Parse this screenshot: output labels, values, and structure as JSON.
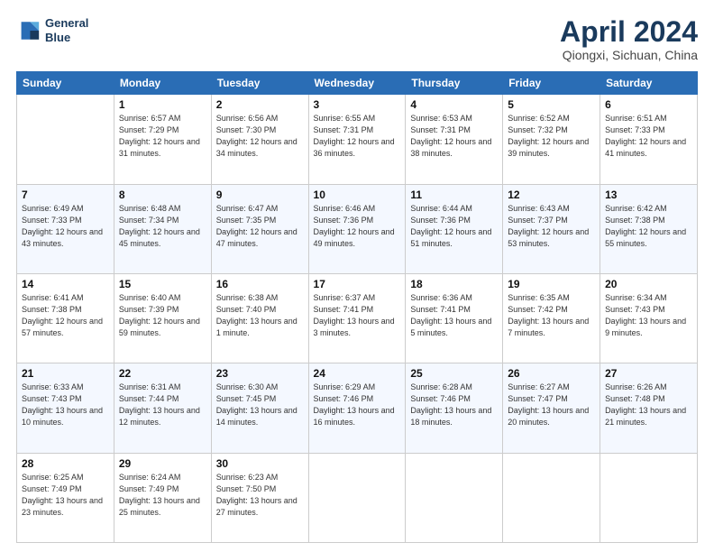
{
  "logo": {
    "line1": "General",
    "line2": "Blue"
  },
  "title": "April 2024",
  "location": "Qiongxi, Sichuan, China",
  "days_of_week": [
    "Sunday",
    "Monday",
    "Tuesday",
    "Wednesday",
    "Thursday",
    "Friday",
    "Saturday"
  ],
  "weeks": [
    [
      {
        "num": "",
        "sunrise": "",
        "sunset": "",
        "daylight": ""
      },
      {
        "num": "1",
        "sunrise": "Sunrise: 6:57 AM",
        "sunset": "Sunset: 7:29 PM",
        "daylight": "Daylight: 12 hours and 31 minutes."
      },
      {
        "num": "2",
        "sunrise": "Sunrise: 6:56 AM",
        "sunset": "Sunset: 7:30 PM",
        "daylight": "Daylight: 12 hours and 34 minutes."
      },
      {
        "num": "3",
        "sunrise": "Sunrise: 6:55 AM",
        "sunset": "Sunset: 7:31 PM",
        "daylight": "Daylight: 12 hours and 36 minutes."
      },
      {
        "num": "4",
        "sunrise": "Sunrise: 6:53 AM",
        "sunset": "Sunset: 7:31 PM",
        "daylight": "Daylight: 12 hours and 38 minutes."
      },
      {
        "num": "5",
        "sunrise": "Sunrise: 6:52 AM",
        "sunset": "Sunset: 7:32 PM",
        "daylight": "Daylight: 12 hours and 39 minutes."
      },
      {
        "num": "6",
        "sunrise": "Sunrise: 6:51 AM",
        "sunset": "Sunset: 7:33 PM",
        "daylight": "Daylight: 12 hours and 41 minutes."
      }
    ],
    [
      {
        "num": "7",
        "sunrise": "Sunrise: 6:49 AM",
        "sunset": "Sunset: 7:33 PM",
        "daylight": "Daylight: 12 hours and 43 minutes."
      },
      {
        "num": "8",
        "sunrise": "Sunrise: 6:48 AM",
        "sunset": "Sunset: 7:34 PM",
        "daylight": "Daylight: 12 hours and 45 minutes."
      },
      {
        "num": "9",
        "sunrise": "Sunrise: 6:47 AM",
        "sunset": "Sunset: 7:35 PM",
        "daylight": "Daylight: 12 hours and 47 minutes."
      },
      {
        "num": "10",
        "sunrise": "Sunrise: 6:46 AM",
        "sunset": "Sunset: 7:36 PM",
        "daylight": "Daylight: 12 hours and 49 minutes."
      },
      {
        "num": "11",
        "sunrise": "Sunrise: 6:44 AM",
        "sunset": "Sunset: 7:36 PM",
        "daylight": "Daylight: 12 hours and 51 minutes."
      },
      {
        "num": "12",
        "sunrise": "Sunrise: 6:43 AM",
        "sunset": "Sunset: 7:37 PM",
        "daylight": "Daylight: 12 hours and 53 minutes."
      },
      {
        "num": "13",
        "sunrise": "Sunrise: 6:42 AM",
        "sunset": "Sunset: 7:38 PM",
        "daylight": "Daylight: 12 hours and 55 minutes."
      }
    ],
    [
      {
        "num": "14",
        "sunrise": "Sunrise: 6:41 AM",
        "sunset": "Sunset: 7:38 PM",
        "daylight": "Daylight: 12 hours and 57 minutes."
      },
      {
        "num": "15",
        "sunrise": "Sunrise: 6:40 AM",
        "sunset": "Sunset: 7:39 PM",
        "daylight": "Daylight: 12 hours and 59 minutes."
      },
      {
        "num": "16",
        "sunrise": "Sunrise: 6:38 AM",
        "sunset": "Sunset: 7:40 PM",
        "daylight": "Daylight: 13 hours and 1 minute."
      },
      {
        "num": "17",
        "sunrise": "Sunrise: 6:37 AM",
        "sunset": "Sunset: 7:41 PM",
        "daylight": "Daylight: 13 hours and 3 minutes."
      },
      {
        "num": "18",
        "sunrise": "Sunrise: 6:36 AM",
        "sunset": "Sunset: 7:41 PM",
        "daylight": "Daylight: 13 hours and 5 minutes."
      },
      {
        "num": "19",
        "sunrise": "Sunrise: 6:35 AM",
        "sunset": "Sunset: 7:42 PM",
        "daylight": "Daylight: 13 hours and 7 minutes."
      },
      {
        "num": "20",
        "sunrise": "Sunrise: 6:34 AM",
        "sunset": "Sunset: 7:43 PM",
        "daylight": "Daylight: 13 hours and 9 minutes."
      }
    ],
    [
      {
        "num": "21",
        "sunrise": "Sunrise: 6:33 AM",
        "sunset": "Sunset: 7:43 PM",
        "daylight": "Daylight: 13 hours and 10 minutes."
      },
      {
        "num": "22",
        "sunrise": "Sunrise: 6:31 AM",
        "sunset": "Sunset: 7:44 PM",
        "daylight": "Daylight: 13 hours and 12 minutes."
      },
      {
        "num": "23",
        "sunrise": "Sunrise: 6:30 AM",
        "sunset": "Sunset: 7:45 PM",
        "daylight": "Daylight: 13 hours and 14 minutes."
      },
      {
        "num": "24",
        "sunrise": "Sunrise: 6:29 AM",
        "sunset": "Sunset: 7:46 PM",
        "daylight": "Daylight: 13 hours and 16 minutes."
      },
      {
        "num": "25",
        "sunrise": "Sunrise: 6:28 AM",
        "sunset": "Sunset: 7:46 PM",
        "daylight": "Daylight: 13 hours and 18 minutes."
      },
      {
        "num": "26",
        "sunrise": "Sunrise: 6:27 AM",
        "sunset": "Sunset: 7:47 PM",
        "daylight": "Daylight: 13 hours and 20 minutes."
      },
      {
        "num": "27",
        "sunrise": "Sunrise: 6:26 AM",
        "sunset": "Sunset: 7:48 PM",
        "daylight": "Daylight: 13 hours and 21 minutes."
      }
    ],
    [
      {
        "num": "28",
        "sunrise": "Sunrise: 6:25 AM",
        "sunset": "Sunset: 7:49 PM",
        "daylight": "Daylight: 13 hours and 23 minutes."
      },
      {
        "num": "29",
        "sunrise": "Sunrise: 6:24 AM",
        "sunset": "Sunset: 7:49 PM",
        "daylight": "Daylight: 13 hours and 25 minutes."
      },
      {
        "num": "30",
        "sunrise": "Sunrise: 6:23 AM",
        "sunset": "Sunset: 7:50 PM",
        "daylight": "Daylight: 13 hours and 27 minutes."
      },
      {
        "num": "",
        "sunrise": "",
        "sunset": "",
        "daylight": ""
      },
      {
        "num": "",
        "sunrise": "",
        "sunset": "",
        "daylight": ""
      },
      {
        "num": "",
        "sunrise": "",
        "sunset": "",
        "daylight": ""
      },
      {
        "num": "",
        "sunrise": "",
        "sunset": "",
        "daylight": ""
      }
    ]
  ]
}
